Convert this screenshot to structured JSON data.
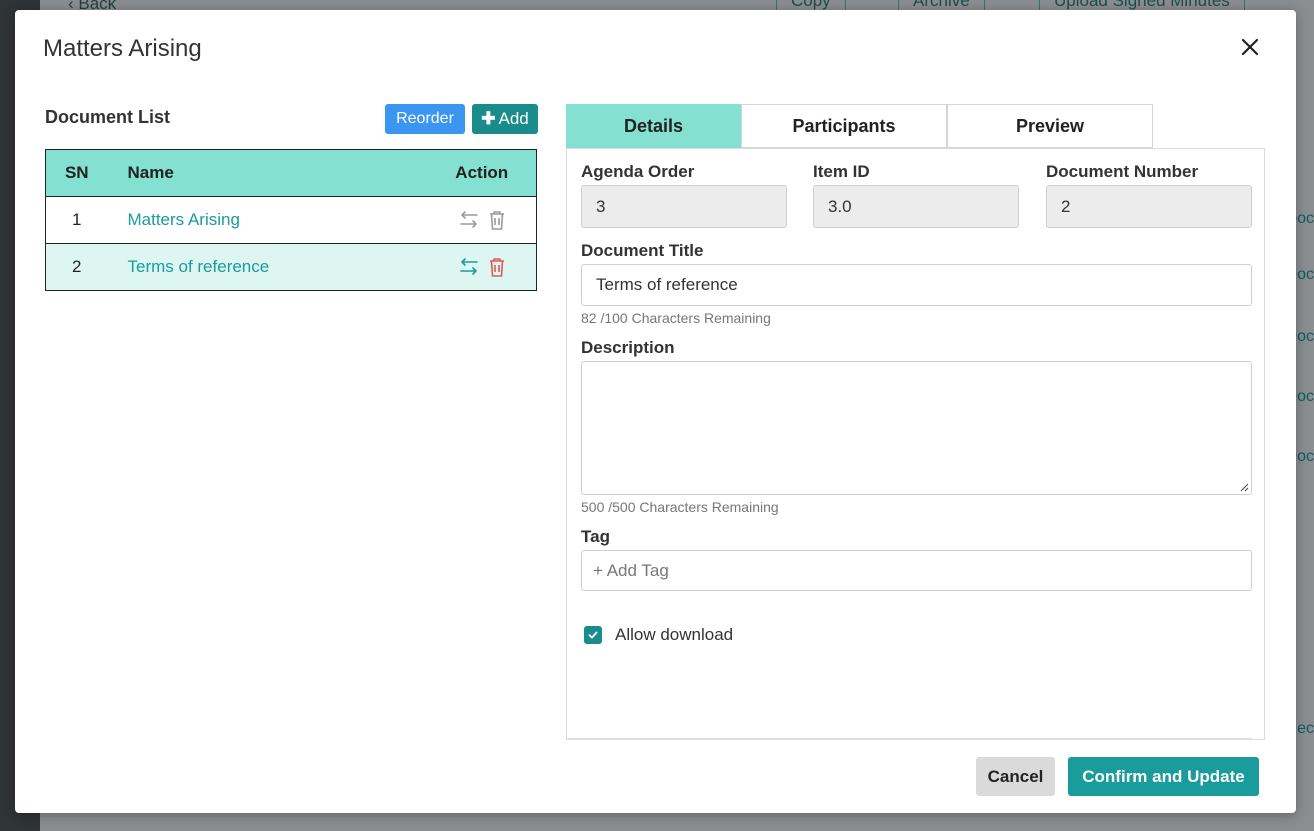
{
  "background": {
    "back_label": "Back",
    "copy_label": "Copy",
    "archive_label": "Archive",
    "upload_label": "Upload Signed Minutes",
    "right_fragments": [
      "ooc",
      "Doc",
      "Doc",
      "Doc",
      "Doc",
      "Rec"
    ]
  },
  "modal": {
    "title": "Matters Arising",
    "close_icon": "close-icon"
  },
  "document_list": {
    "title": "Document List",
    "reorder_label": "Reorder",
    "add_label": "Add",
    "columns": [
      "SN",
      "Name",
      "Action"
    ],
    "rows": [
      {
        "sn": "1",
        "name": "Matters Arising",
        "selected": false
      },
      {
        "sn": "2",
        "name": "Terms of reference",
        "selected": true
      }
    ]
  },
  "tabs": [
    {
      "label": "Details",
      "active": true
    },
    {
      "label": "Participants",
      "active": false
    },
    {
      "label": "Preview",
      "active": false
    }
  ],
  "details": {
    "agenda_order_label": "Agenda Order",
    "agenda_order_value": "3",
    "item_id_label": "Item ID",
    "item_id_value": "3.0",
    "document_number_label": "Document Number",
    "document_number_value": "2",
    "document_title_label": "Document Title",
    "document_title_value": "Terms of reference",
    "title_chars_remaining": "82 /100 Characters Remaining",
    "description_label": "Description",
    "description_value": "",
    "description_chars_remaining": "500 /500 Characters Remaining",
    "tag_label": "Tag",
    "tag_placeholder": "+ Add Tag",
    "allow_download_label": "Allow download",
    "allow_download_checked": true
  },
  "footer": {
    "cancel_label": "Cancel",
    "confirm_label": "Confirm and Update"
  },
  "colors": {
    "teal_accent": "#1a9c9c",
    "header_mint": "#84e0d0",
    "selected_row": "#ddf6f2",
    "reorder_blue": "#3a96f0",
    "delete_red": "#e05a5a"
  }
}
